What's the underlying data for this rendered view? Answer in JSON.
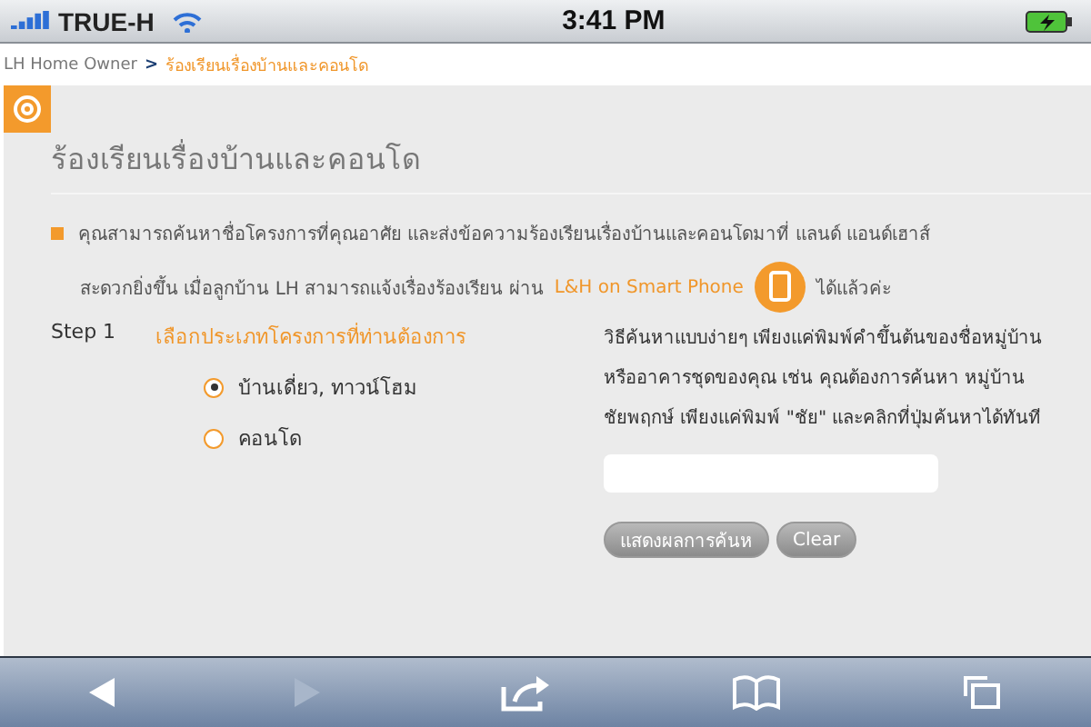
{
  "status_bar": {
    "carrier": "TRUE-H",
    "time": "3:41 PM"
  },
  "breadcrumb": {
    "home": "LH Home Owner",
    "separator": ">",
    "current": "ร้องเรียนเรื่องบ้านและคอนโด"
  },
  "page": {
    "title": "ร้องเรียนเรื่องบ้านและคอนโด",
    "intro": "คุณสามารถค้นหาชื่อโครงการที่คุณอาศัย และส่งข้อความร้องเรียนเรื่องบ้านและคอนโดมาที่ แลนด์ แอนด์เฮาส์",
    "note_before": "สะดวกยิ่งขึ้น เมื่อลูกบ้าน LH สามารถแจ้งเรื่องร้องเรียน ผ่าน",
    "note_link": "L&H on Smart Phone",
    "note_after": "ได้แล้วค่ะ"
  },
  "step": {
    "label": "Step 1",
    "heading": "เลือกประเภทโครงการที่ท่านต้องการ",
    "options": [
      {
        "label": "บ้านเดี่ยว, ทาวน์โฮม",
        "selected": true
      },
      {
        "label": "คอนโด",
        "selected": false
      }
    ]
  },
  "search": {
    "help": "วิธีค้นหาแบบง่ายๆ เพียงแค่พิมพ์คำขึ้นต้นของชื่อหมู่บ้านหรืออาคารชุดของคุณ เช่น คุณต้องการค้นหา หมู่บ้าน ชัยพฤกษ์ เพียงแค่พิมพ์ \"ชัย\" และคลิกที่ปุ่มค้นหาได้ทันที",
    "buttons": [
      "แสดงผลการค้นห",
      "Clear"
    ]
  },
  "toolbar": [
    {
      "kind": "back",
      "disabled": false
    },
    {
      "kind": "forward",
      "disabled": true
    },
    {
      "kind": "share",
      "disabled": false
    },
    {
      "kind": "bookmarks",
      "disabled": false
    },
    {
      "kind": "tabs",
      "disabled": false
    }
  ]
}
